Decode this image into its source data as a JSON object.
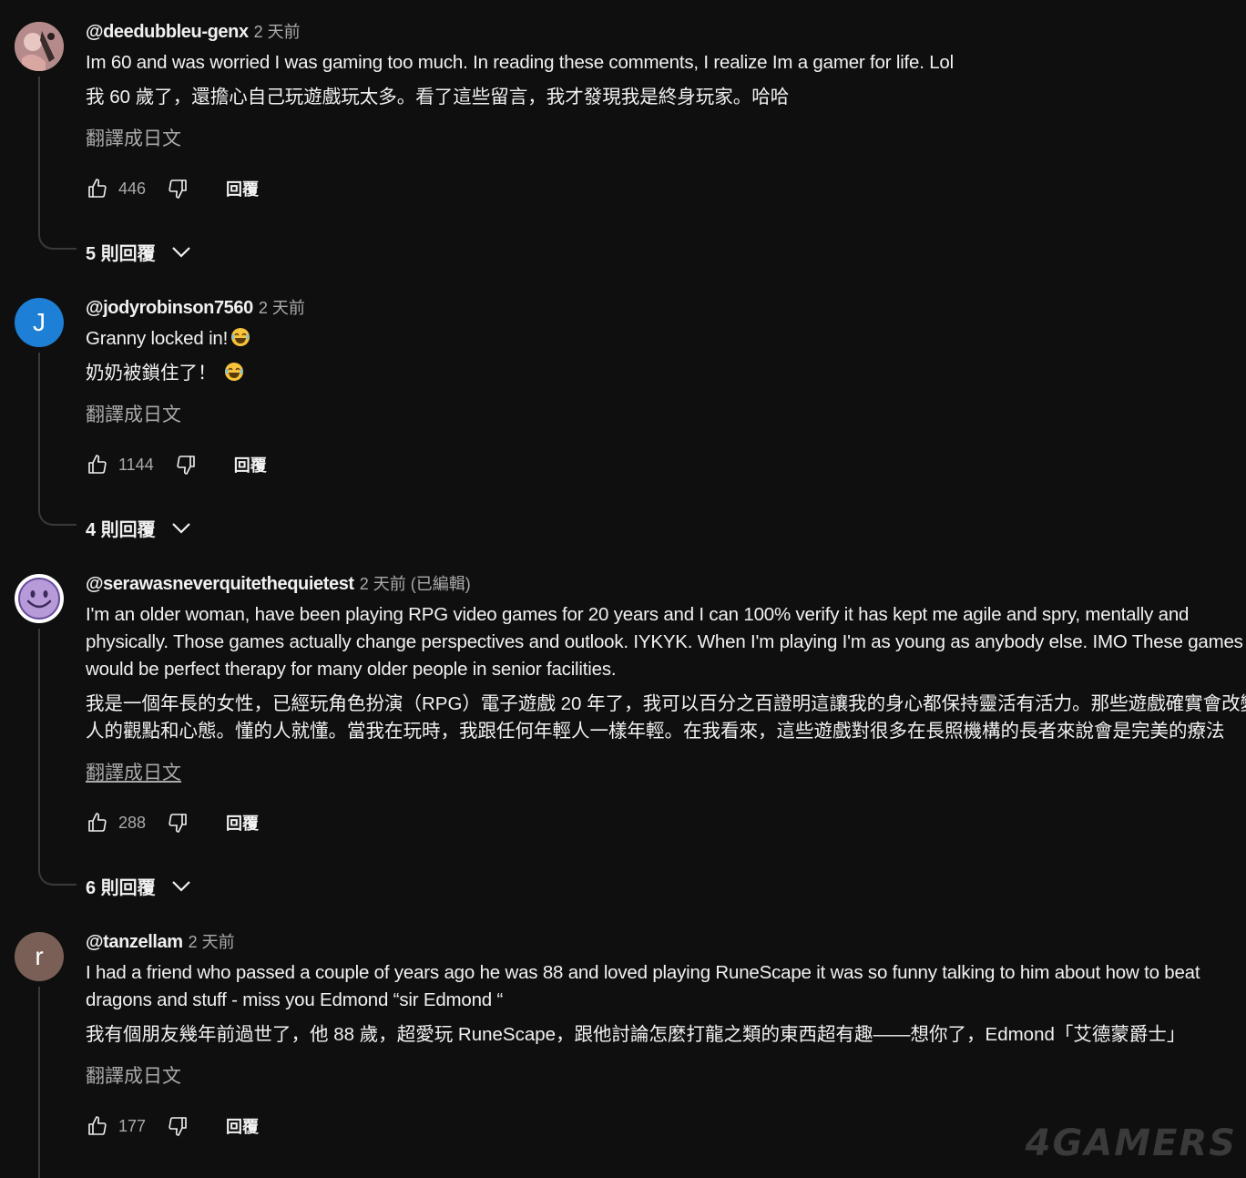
{
  "comments": [
    {
      "author": "@deedubbleu-genx",
      "time": "2 天前",
      "text": "Im 60 and was worried I was gaming too much. In reading these comments, I realize Im a gamer for life. Lol",
      "translated": "我 60 歲了，還擔心自己玩遊戲玩太多。看了這些留言，我才發現我是終身玩家。哈哈",
      "translate_label": "翻譯成日文",
      "likes": "446",
      "reply_label": "回覆",
      "replies_label": "5 則回覆",
      "avatar_type": "photo"
    },
    {
      "author": "@jodyrobinson7560",
      "time": "2 天前",
      "text": "Granny locked in!",
      "translated": "奶奶被鎖住了！",
      "translate_label": "翻譯成日文",
      "likes": "1144",
      "reply_label": "回覆",
      "replies_label": "4 則回覆",
      "avatar_letter": "J",
      "avatar_color": "#1e7fd6",
      "emoji": "laughing-emoji"
    },
    {
      "author": "@serawasneverquitethequietest",
      "time": "2 天前 (已編輯)",
      "text": "I'm an older woman, have been playing RPG video games for 20 years and I can 100% verify it has kept me agile and spry, mentally and physically.  Those games actually change perspectives and outlook.  IYKYK.  When I'm playing I'm as young as anybody else.  IMO These games would be perfect therapy for many older people in senior facilities.",
      "translated": "我是一個年長的女性，已經玩角色扮演（RPG）電子遊戲 20 年了，我可以百分之百證明這讓我的身心都保持靈活有活力。那些遊戲確實會改變人的觀點和心態。懂的人就懂。當我在玩時，我跟任何年輕人一樣年輕。在我看來，這些遊戲對很多在長照機構的長者來說會是完美的療法",
      "translate_label": "翻譯成日文",
      "likes": "288",
      "reply_label": "回覆",
      "replies_label": "6 則回覆",
      "avatar_type": "smiley",
      "avatar_color": "#b79ad8"
    },
    {
      "author": "@tanzellam",
      "time": "2 天前",
      "text": "I had a friend who passed a couple of years ago he was 88 and loved playing RuneScape it was so funny talking to him about how to beat dragons and stuff - miss you Edmond “sir Edmond “",
      "translated": "我有個朋友幾年前過世了，他 88 歲，超愛玩 RuneScape，跟他討論怎麼打龍之類的東西超有趣——想你了，Edmond「艾德蒙爵士」",
      "translate_label": "翻譯成日文",
      "likes": "177",
      "reply_label": "回覆",
      "avatar_letter": "r",
      "avatar_color": "#7a5f57"
    }
  ],
  "watermark": "4GAMERS",
  "icons": {
    "like": "thumbs-up-icon",
    "dislike": "thumbs-down-icon",
    "expand": "chevron-down-icon"
  }
}
